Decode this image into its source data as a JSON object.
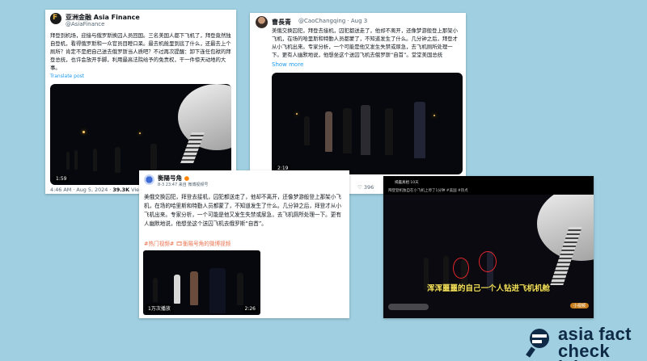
{
  "tweet1": {
    "name": "亚洲金融 Asia Finance",
    "handle": "@AsiaFinance",
    "text": "拜登到机场，迎接与俄罗斯换囚人员回国。三名美国人都下飞机了，拜登竟然独自登机，看得俄罗斯和一众官员目瞪口呆。最去机舱里到底了什么，还最去上个厕所？肯定不是把自己送去俄罗斯当人质吧？不过再次提醒：卸下连任包袱的拜登总统，也许会放开手脚，利用最高法院给予的免责权，干一件惊天动地的大事。",
    "translate": "Translate post",
    "duration": "1:59",
    "meta": "4:46 AM · Aug 5, 2024 · ",
    "views": "39.3K",
    "views_label": " Views"
  },
  "tweet2": {
    "name": "曹長青",
    "handle": "@CaoChangqing · Aug 3",
    "text": "美俄交换囚犯，拜登去接机，囚犯都送走了，他却不离开，还像梦游般登上那架小飞机，在场的哈里斯和特勤人员都蒙了，不知道发生了什么。几分钟之后，拜登才从小飞机出来。专家分析，一个可能是他又发生失禁或尿急，去飞机厕所处理一下。更有人幽默地说，他想坐这个送囚飞机去俄罗斯“自首”。堂堂美国总统",
    "show_more": "Show more",
    "duration": "2:19",
    "likes": "396"
  },
  "weibo": {
    "name": "衡陽号角",
    "meta": "8-3 23:47 来自 微博视频号",
    "text": "美俄交换囚犯，拜登去接机，囚犯都送走了，他却不离开，还像梦游般登上那架小飞机，在场的哈里斯和特勤人员都蒙了，不知道发生了什么。几分钟之后，拜登才从小飞机出来。专家分析，一个可能是他又发生失禁或尿急，去飞机厕所处理一下。更有人幽默地说，他想坐这个送囚飞机去俄罗斯“自首”。",
    "hashtags": "#热门视频# 🎞衡陽号角的微博视频",
    "views": "1万次播放",
    "duration": "2:26"
  },
  "douyin": {
    "header": "揭露真相 10天",
    "subheader": "拜登登机独自在小飞机上停了1分钟 #美国 #热点",
    "caption": "浑浑噩噩的自己一个人钻进飞机机舱",
    "pill": "小视频"
  },
  "logo": {
    "line1": "asia fact",
    "line2": "check lab"
  },
  "colors": {
    "background": "#9fcfe0",
    "logo": "#0e2a47",
    "highlight_circle": "#e0262b",
    "caption": "#f6e25a"
  }
}
